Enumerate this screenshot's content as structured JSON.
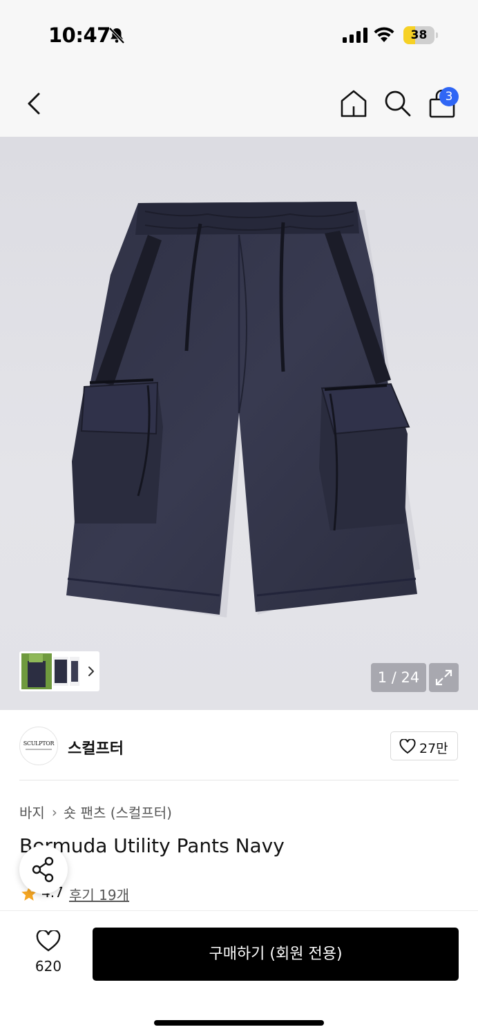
{
  "status_bar": {
    "time": "10:47",
    "battery_level": "38",
    "battery_fraction": 0.38,
    "icons": [
      "bell-slash-icon",
      "cellular-signal-icon",
      "wifi-icon",
      "battery-icon"
    ]
  },
  "nav": {
    "icons": [
      "chevron-left-icon",
      "home-icon",
      "search-icon",
      "shopping-bag-icon"
    ],
    "cart_count": "3",
    "badge_color": "#2f66f5"
  },
  "gallery": {
    "counter": "1 / 24",
    "icons": [
      "chevron-right-icon",
      "expand-icon"
    ]
  },
  "brand": {
    "name": "스컬프터",
    "logo_text": "SCULPTOR",
    "like_count": "27만"
  },
  "product": {
    "breadcrumb": [
      "바지",
      "숏 팬츠 (스컬프터)"
    ],
    "title": "Bermuda Utility Pants Navy",
    "rating": "4.7",
    "reviews_label": "후기 19개",
    "star_color": "#f5a623"
  },
  "bottom_bar": {
    "wish_count": "620",
    "buy_label": "구매하기 (회원 전용)"
  }
}
